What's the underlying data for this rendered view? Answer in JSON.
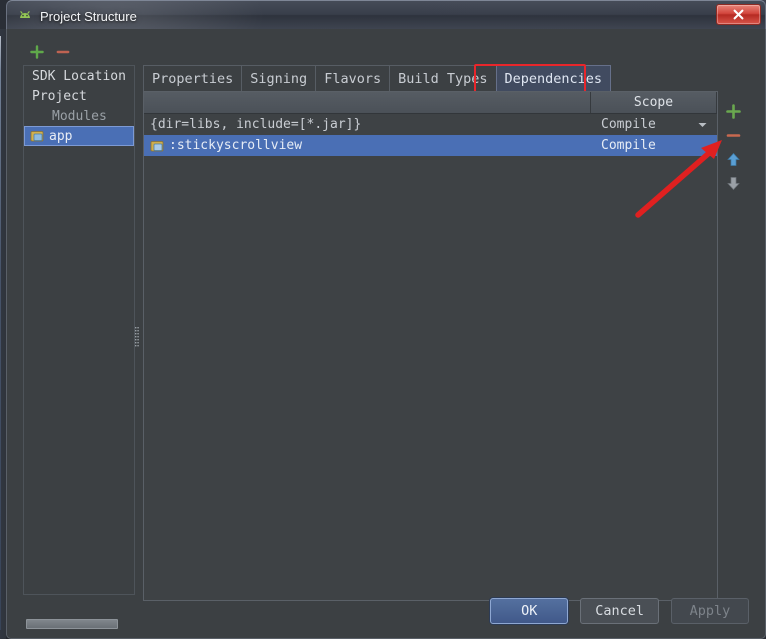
{
  "window": {
    "title": "Project Structure",
    "app_icon": "android-studio-icon",
    "close_label": "x"
  },
  "sidebar": {
    "toolbar": {
      "add_icon": "plus-icon",
      "remove_icon": "minus-icon"
    },
    "items": [
      {
        "label": "SDK Location",
        "type": "item",
        "selected": false
      },
      {
        "label": "Project",
        "type": "item",
        "selected": false
      },
      {
        "label": "Modules",
        "type": "group",
        "selected": false
      },
      {
        "label": "app",
        "type": "item",
        "selected": true,
        "icon": "module-icon"
      }
    ]
  },
  "tabs": [
    {
      "label": "Properties",
      "active": false
    },
    {
      "label": "Signing",
      "active": false
    },
    {
      "label": "Flavors",
      "active": false
    },
    {
      "label": "Build Types",
      "active": false
    },
    {
      "label": "Dependencies",
      "active": true
    }
  ],
  "annotations": {
    "tab_highlight_color": "#e8262b",
    "arrow_color": "#e02020",
    "arrow_target": "remove-dependency-button"
  },
  "table": {
    "columns": [
      {
        "label": "",
        "key": "dependency"
      },
      {
        "label": "Scope",
        "key": "scope"
      }
    ],
    "rows": [
      {
        "dependency": "{dir=libs, include=[*.jar]}",
        "scope": "Compile",
        "icon": "",
        "selected": false,
        "has_dropdown": true
      },
      {
        "dependency": ":stickyscrollview",
        "scope": "Compile",
        "icon": "module-icon",
        "selected": true,
        "has_dropdown": false
      }
    ]
  },
  "right_toolbar": [
    {
      "name": "add-dependency-button",
      "icon": "plus-icon",
      "color": "#6aa84f"
    },
    {
      "name": "remove-dependency-button",
      "icon": "minus-icon",
      "color": "#c8694f"
    },
    {
      "name": "move-up-button",
      "icon": "arrow-up-icon",
      "color": "#5a9fd4"
    },
    {
      "name": "move-down-button",
      "icon": "arrow-down-icon",
      "color": "#9aa0a6"
    }
  ],
  "footer": {
    "ok_label": "OK",
    "cancel_label": "Cancel",
    "apply_label": "Apply",
    "apply_disabled": true
  },
  "colors": {
    "dialog_bg": "#3c4043",
    "table_bg": "#3e4245",
    "selection_blue": "#4a6fb5",
    "accent_red": "#e8262b"
  }
}
